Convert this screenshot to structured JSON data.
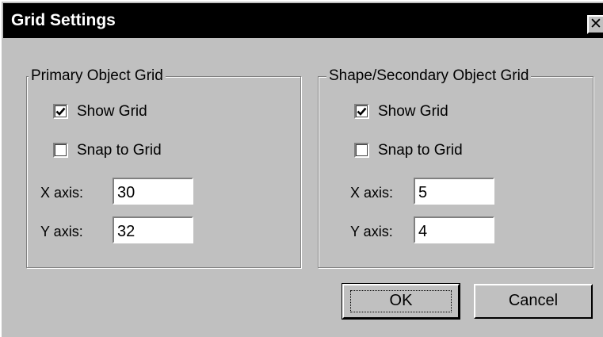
{
  "dialog": {
    "title": "Grid Settings",
    "close_glyph": "✕",
    "close_icon": "close-icon"
  },
  "primary": {
    "legend": "Primary Object Grid",
    "show_grid": {
      "label": "Show Grid",
      "checked": true
    },
    "snap_to_grid": {
      "label": "Snap to Grid",
      "checked": false
    },
    "x_axis": {
      "label": "X axis:",
      "value": "30"
    },
    "y_axis": {
      "label": "Y axis:",
      "value": "32"
    }
  },
  "secondary": {
    "legend": "Shape/Secondary Object Grid",
    "show_grid": {
      "label": "Show Grid",
      "checked": true
    },
    "snap_to_grid": {
      "label": "Snap to Grid",
      "checked": false
    },
    "x_axis": {
      "label": "X axis:",
      "value": "5"
    },
    "y_axis": {
      "label": "Y axis:",
      "value": "4"
    }
  },
  "buttons": {
    "ok": "OK",
    "cancel": "Cancel"
  },
  "colors": {
    "face": "#c0c0c0",
    "titlebar": "#000000",
    "title_text": "#ffffff"
  }
}
